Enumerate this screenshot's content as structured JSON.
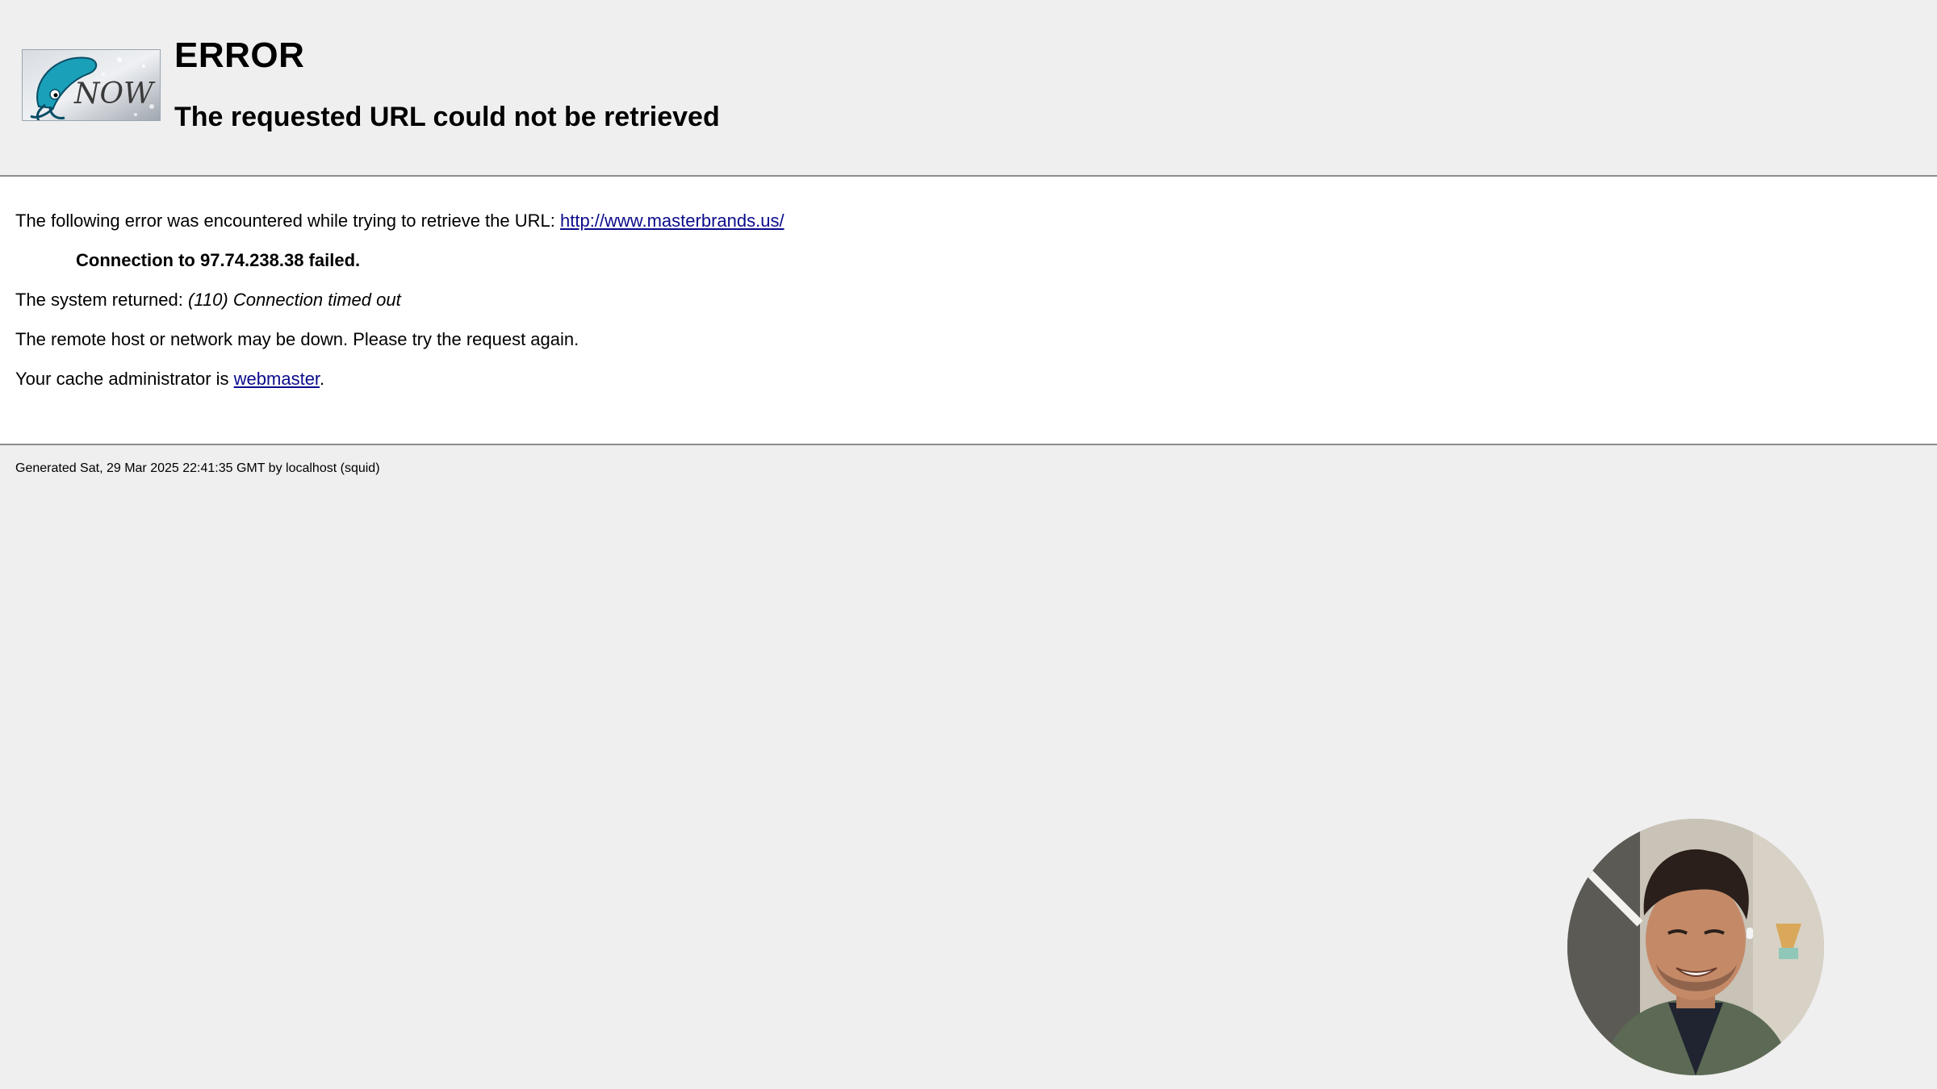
{
  "header": {
    "logo_icon": "squid-now-logo",
    "title": "ERROR",
    "subtitle": "The requested URL could not be retrieved"
  },
  "content": {
    "intro_text": "The following error was encountered while trying to retrieve the URL: ",
    "url_link": "http://www.masterbrands.us/",
    "connection_failed": "Connection to 97.74.238.38 failed.",
    "system_returned_label": "The system returned: ",
    "system_returned_value": "(110) Connection timed out",
    "remote_host_text": "The remote host or network may be down. Please try the request again.",
    "admin_text": "Your cache administrator is ",
    "admin_link": "webmaster",
    "admin_suffix": "."
  },
  "footer": {
    "generated_text": "Generated Sat, 29 Mar 2025 22:41:35 GMT by localhost (squid)"
  },
  "overlay": {
    "webcam_icon": "presenter-webcam"
  }
}
